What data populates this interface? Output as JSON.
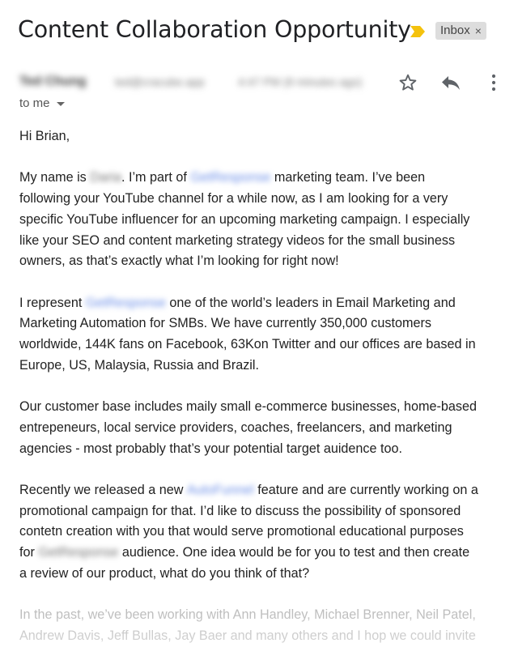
{
  "email": {
    "subject": "Content Collaboration Opportunity",
    "label_chip": "Inbox",
    "label_chip_close": "×",
    "sender": {
      "name": "Ted Chung",
      "email": "ted@cracube.app",
      "time": "4:47 PM (8 minutes ago)"
    },
    "recipient": "to me",
    "redacted": {
      "person": "Daria",
      "company": "GetResponse",
      "feature": "AutoFunnel"
    },
    "body": {
      "greeting": "Hi Brian,",
      "p1": {
        "l1_a": "My name is",
        "l1_b": ". I’m part of",
        "l1_c": "marketing team. I’ve been",
        "l2": "following your YouTube channel for a while now, as I am looking for a very",
        "l3": "specific YouTube influencer for an upcoming marketing campaign. I especially",
        "l4": "like your SEO and content marketing strategy videos for the small business",
        "l5": "owners, as that’s exactly what I’m looking for right now!"
      },
      "p2": {
        "l1_a": "I represent",
        "l1_b": "one of the world’s leaders in Email Marketing and",
        "l2": "Marketing Automation for SMBs. We have currently 350,000 customers",
        "l3": "worldwide, 144K fans on Facebook, 63Kon Twitter and our offices are based in",
        "l4": "Europe, US, Malaysia, Russia and Brazil."
      },
      "p3": {
        "l1": "Our customer base includes maily small e-commerce businesses, home-based",
        "l2": "entrepeneurs, local service providers, coaches, freelancers, and marketing",
        "l3": "agencies - most probably that’s your potential target auidence too."
      },
      "p4": {
        "l1_a": "Recently we released a new",
        "l1_b": "feature and are currently working on a",
        "l2": "promotional campaign for that. I’d like to discuss the possibility of sponsored",
        "l3": "contetn creation with you that would serve promotional educational purposes",
        "l4_a": "for",
        "l4_b": "audience. One idea would be for you to test and then create",
        "l5": "a review of our product, what do you think of that?"
      },
      "p5": {
        "l1": "In the past, we’ve been working with Ann Handley, Michael Brenner, Neil Patel,",
        "l2": "Andrew Davis, Jeff Bullas, Jay Baer and many others and I hop we could invite"
      }
    }
  },
  "icons": {
    "importance": "importance-marker-icon",
    "star": "star-icon",
    "reply": "reply-icon",
    "more": "more-vert-icon",
    "dropdown": "chevron-down-icon"
  },
  "colors": {
    "importance_marker": "#f4c20d",
    "link_blue": "#6c8fe8",
    "chip_bg": "#dddddd",
    "faded_text": "#b4b4b4"
  }
}
